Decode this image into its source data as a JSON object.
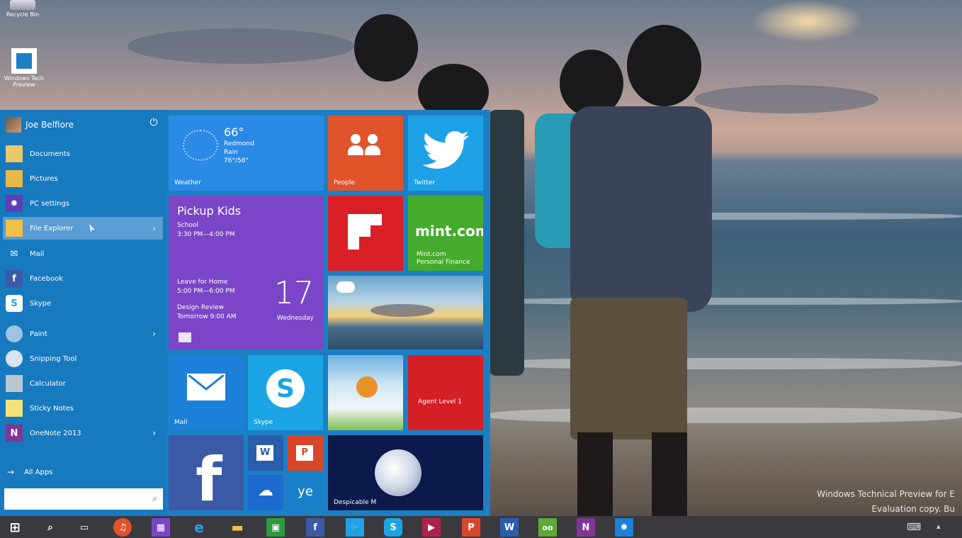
{
  "desktop": {
    "icons": [
      {
        "name": "recycle-bin-icon",
        "label": "Recycle Bin"
      },
      {
        "name": "windows-feedback-icon",
        "label": "Windows Tech Preview"
      }
    ],
    "watermark": {
      "line1": "Windows Technical Preview for E",
      "line2": "Evaluation copy. Bu"
    }
  },
  "start_menu": {
    "user_name": "Joe Belfiore",
    "power_icon": "power-icon",
    "items": [
      {
        "label": "Documents",
        "icon": "documents-icon",
        "has_arrow": false
      },
      {
        "label": "Pictures",
        "icon": "pictures-icon",
        "has_arrow": false
      },
      {
        "label": "PC settings",
        "icon": "gear-icon",
        "has_arrow": false
      },
      {
        "label": "File Explorer",
        "icon": "file-explorer-icon",
        "has_arrow": true,
        "selected": true
      },
      {
        "label": "Mail",
        "icon": "mail-icon",
        "has_arrow": false
      },
      {
        "label": "Facebook",
        "icon": "facebook-icon",
        "has_arrow": false
      },
      {
        "label": "Skype",
        "icon": "skype-icon",
        "has_arrow": false
      },
      {
        "label": "Paint",
        "icon": "paint-icon",
        "has_arrow": true
      },
      {
        "label": "Snipping Tool",
        "icon": "snipping-tool-icon",
        "has_arrow": false
      },
      {
        "label": "Calculator",
        "icon": "calculator-icon",
        "has_arrow": false
      },
      {
        "label": "Sticky Notes",
        "icon": "sticky-notes-icon",
        "has_arrow": false
      },
      {
        "label": "OneNote 2013",
        "icon": "onenote-icon",
        "has_arrow": true
      }
    ],
    "arrow_glyph": "›",
    "all_apps_arrow": "→",
    "all_apps_label": "All Apps",
    "search_placeholder": "",
    "search_glyph": "⌕"
  },
  "tiles": {
    "weather": {
      "temp": "66°",
      "location": "Redmond",
      "condition": "Rain",
      "range": "76°/58°",
      "label": "Weather"
    },
    "people": {
      "label": "People"
    },
    "twitter": {
      "label": "Twitter"
    },
    "calendar": {
      "title": "Pickup Kids",
      "ev1_line1": "School",
      "ev1_line2": "3:30 PM—4:00 PM",
      "ev2_line1": "Leave for Home",
      "ev2_line2": "5:00 PM—6:00 PM",
      "ev3_line1": "Design Review",
      "ev3_line2": "Tomorrow 9:00 AM",
      "day_number": "17",
      "day_name": "Wednesday"
    },
    "flipboard": {
      "label": ""
    },
    "mint": {
      "logo": "mint.com",
      "label_line1": "Mint.com",
      "label_line2": "Personal Finance"
    },
    "tripadvisor": {
      "label": ""
    },
    "mail": {
      "label": "Mail"
    },
    "skype": {
      "label": "Skype",
      "glyph": "S"
    },
    "game": {
      "label": ""
    },
    "agent": {
      "label": "Agent Level 1"
    },
    "facebook": {
      "glyph": "f"
    },
    "word": {
      "glyph": "W"
    },
    "powerpoint": {
      "glyph": "P"
    },
    "onedrive": {
      "glyph": "☁"
    },
    "yammer": {
      "glyph": "ye"
    },
    "despicable": {
      "label": "Despicable M"
    }
  },
  "taskbar": {
    "start_glyph": "⊞",
    "search_glyph": "⌕",
    "items": [
      "task-view-icon",
      "music-icon",
      "calculator-icon",
      "internet-explorer-icon",
      "file-explorer-icon",
      "store-icon",
      "facebook-icon",
      "twitter-icon",
      "skype-icon",
      "video-icon",
      "powerpoint-icon",
      "word-icon",
      "tripadvisor-icon",
      "onenote-icon",
      "settings-icon"
    ],
    "glyphs": {
      "task-view-icon": "▭",
      "music-icon": "♫",
      "calculator-icon": "▦",
      "internet-explorer-icon": "e",
      "file-explorer-icon": "▬",
      "store-icon": "▣",
      "facebook-icon": "f",
      "twitter-icon": "🐦",
      "skype-icon": "S",
      "video-icon": "▶",
      "powerpoint-icon": "P",
      "word-icon": "W",
      "tripadvisor-icon": "oo",
      "onenote-icon": "N",
      "settings-icon": "✹"
    },
    "keyboard_glyph": "⌨",
    "chevron_glyph": "▴"
  },
  "colors": {
    "start_bg": "#1c7fc4",
    "weather": "#2a8ae6",
    "people": "#e0532b",
    "twitter": "#1ea1e7",
    "calendar": "#7b45c7",
    "flipboard": "#d81f26",
    "mint": "#45ab2c",
    "mail": "#1c7fd8",
    "skype": "#1ba5e5",
    "agent": "#d41f25",
    "facebook": "#3b5aa6",
    "word": "#2a5eac",
    "powerpoint": "#d9472b",
    "onedrive": "#1c6ad0",
    "yammer": "#1880c9"
  }
}
